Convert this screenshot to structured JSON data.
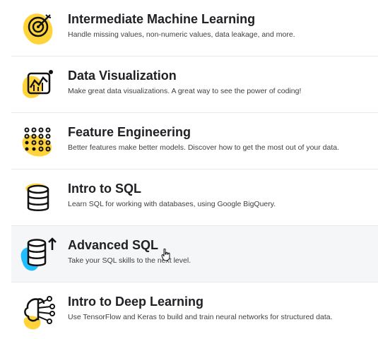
{
  "courses": [
    {
      "title": "Intermediate Machine Learning",
      "description": "Handle missing values, non-numeric values, data leakage, and more.",
      "icon": "target-icon"
    },
    {
      "title": "Data Visualization",
      "description": "Make great data visualizations. A great way to see the power of coding!",
      "icon": "chart-icon"
    },
    {
      "title": "Feature Engineering",
      "description": "Better features make better models. Discover how to get the most out of your data.",
      "icon": "dot-grid-icon"
    },
    {
      "title": "Intro to SQL",
      "description": "Learn SQL for working with databases, using Google BigQuery.",
      "icon": "database-icon"
    },
    {
      "title": "Advanced SQL",
      "description": "Take your SQL skills to the next level.",
      "icon": "database-arrow-icon"
    },
    {
      "title": "Intro to Deep Learning",
      "description": "Use TensorFlow and Keras to build and train neural networks for structured data.",
      "icon": "neural-network-icon"
    }
  ],
  "colors": {
    "accent_yellow": "#FFD43B",
    "accent_blue": "#20BEFF",
    "text": "#202124"
  }
}
